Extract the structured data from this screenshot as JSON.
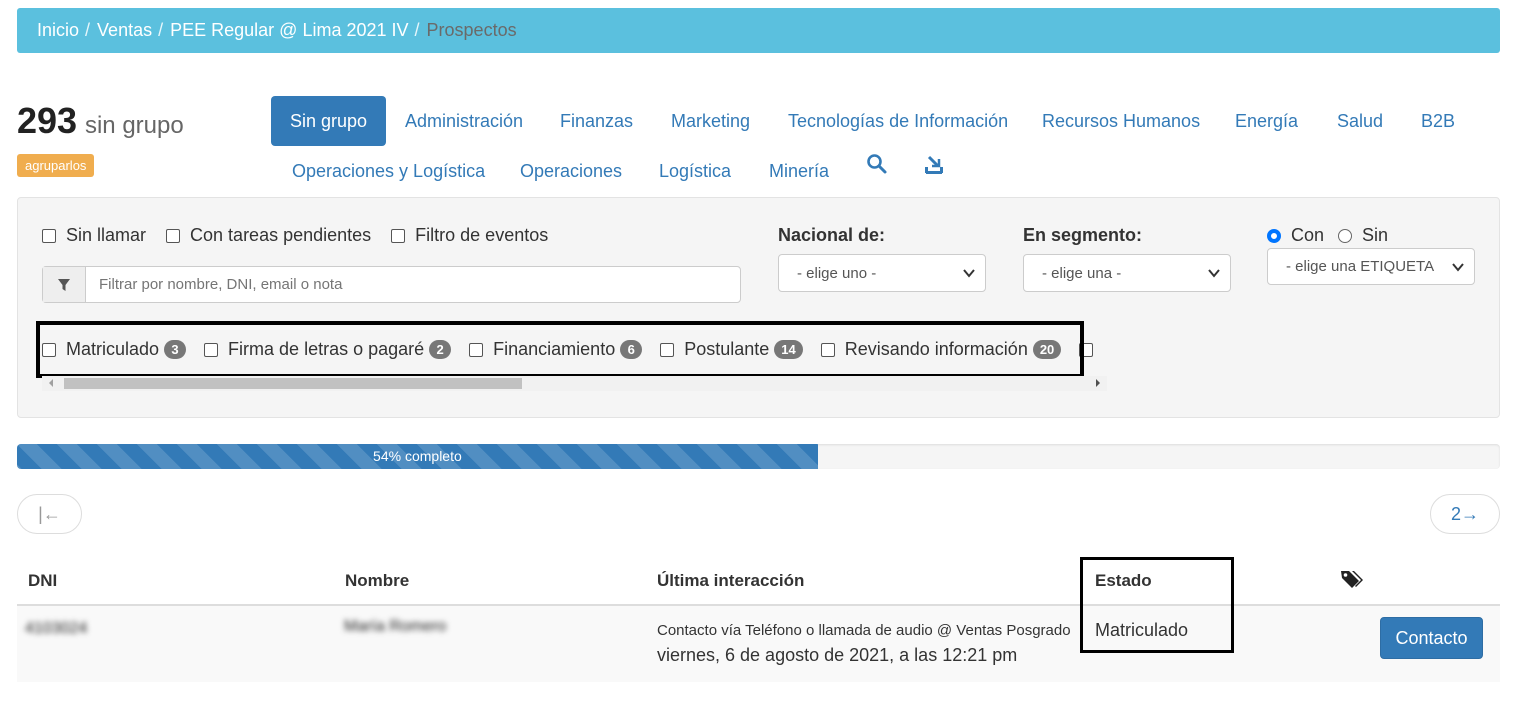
{
  "breadcrumb": {
    "items": [
      "Inicio",
      "Ventas",
      "PEE Regular @ Lima 2021 IV"
    ],
    "separator": "/",
    "active": "Prospectos"
  },
  "summary": {
    "count": "293",
    "label": "sin grupo",
    "group_button": "agruparlos"
  },
  "tabs": {
    "row1": [
      "Sin grupo",
      "Administración",
      "Finanzas",
      "Marketing",
      "Tecnologías de Información",
      "Recursos Humanos",
      "Energía",
      "Salud",
      "B2B"
    ],
    "row2": [
      "Operaciones y Logística",
      "Operaciones",
      "Logística",
      "Minería"
    ],
    "active": "Sin grupo",
    "icons": [
      "search-icon",
      "export-icon"
    ]
  },
  "filters": {
    "checkboxes": [
      "Sin llamar",
      "Con tareas pendientes",
      "Filtro de eventos"
    ],
    "search_placeholder": "Filtrar por nombre, DNI, email o nota",
    "nacional_label": "Nacional de:",
    "nacional_value": "- elige uno -",
    "segmento_label": "En segmento:",
    "segmento_value": "- elige una -",
    "radio_con": "Con",
    "radio_sin": "Sin",
    "radio_selected": "Con",
    "etiqueta_value": "- elige una ETIQUETA -"
  },
  "status_filters": [
    {
      "label": "Matriculado",
      "count": "3"
    },
    {
      "label": "Firma de letras o pagaré",
      "count": "2"
    },
    {
      "label": "Financiamiento",
      "count": "6"
    },
    {
      "label": "Postulante",
      "count": "14"
    },
    {
      "label": "Revisando información",
      "count": "20"
    }
  ],
  "progress": {
    "value": 0.54,
    "label": "54% completo"
  },
  "pager": {
    "prev": "|←",
    "next": "2→"
  },
  "table": {
    "headers": [
      "DNI",
      "Nombre",
      "Última interacción",
      "Estado"
    ],
    "tag_icon": "tags-icon",
    "rows": [
      {
        "dni": "4103024",
        "nombre": "María Romero",
        "interaction_line1": "Contacto vía Teléfono o llamada de audio @ Ventas Posgrado",
        "interaction_line2": "viernes, 6 de agosto de 2021, a las 12:21 pm",
        "estado": "Matriculado",
        "action": "Contacto"
      }
    ]
  },
  "colors": {
    "breadcrumb_bg": "#5bc0de",
    "primary": "#337ab7",
    "warning": "#f0ad4e",
    "badge": "#777777"
  }
}
